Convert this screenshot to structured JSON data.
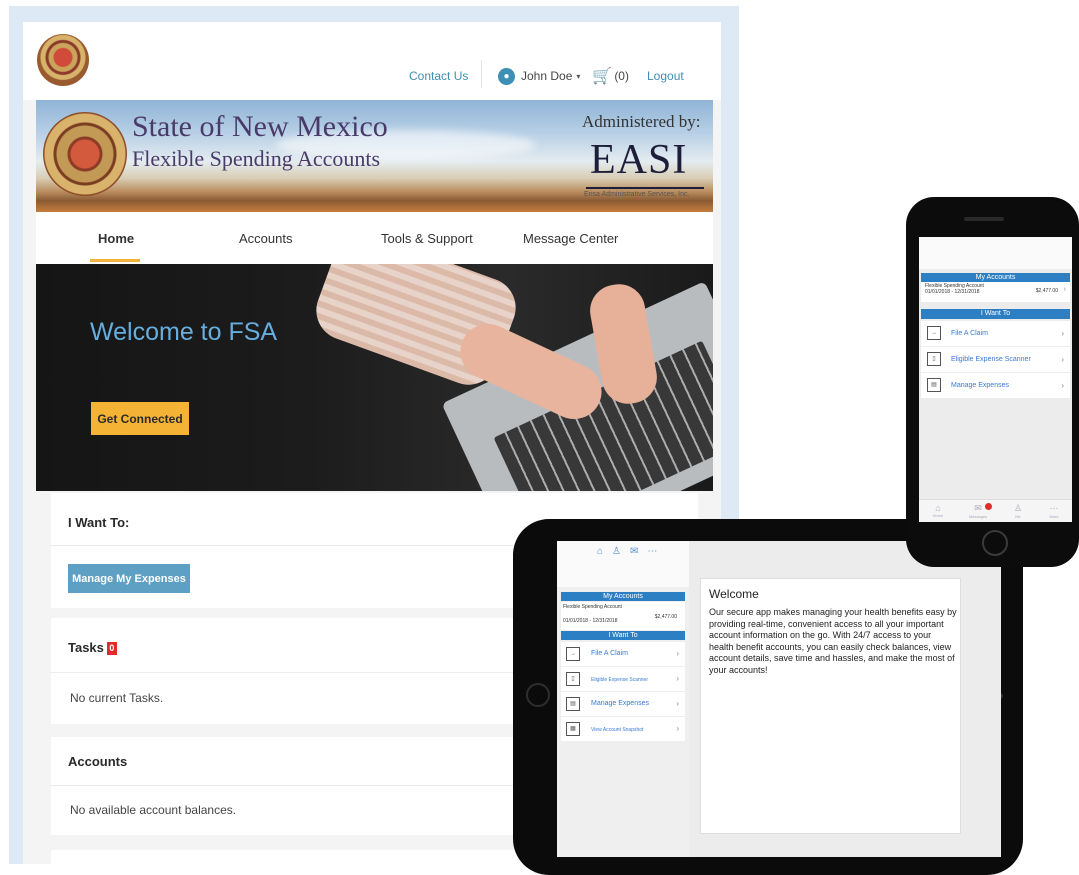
{
  "topbar": {
    "contact_label": "Contact Us",
    "user_name": "John Doe",
    "cart_count": "(0)",
    "logout_label": "Logout"
  },
  "banner": {
    "title": "State of New Mexico",
    "subtitle": "Flexible Spending Accounts",
    "administered_by": "Administered by:",
    "admin_logo": "EASI",
    "admin_fullname": "Erisa Administrative Services, Inc."
  },
  "nav": {
    "items": [
      "Home",
      "Accounts",
      "Tools & Support",
      "Message Center"
    ],
    "active": "Home"
  },
  "hero": {
    "title": "Welcome to FSA",
    "button_label": "Get Connected"
  },
  "i_want_to": {
    "heading": "I Want To:",
    "button_label": "Manage My Expenses"
  },
  "tasks": {
    "heading": "Tasks",
    "badge": "0",
    "empty_text": "No current Tasks."
  },
  "accounts": {
    "heading": "Accounts",
    "empty_text": "No available account balances."
  },
  "tablet": {
    "my_accounts_label": "My Accounts",
    "account_name": "Flexible Spending Account",
    "account_dates": "01/01/2018 - 12/31/2018",
    "account_amount": "$2,477.00",
    "i_want_to_label": "I Want To",
    "items": [
      "File A Claim",
      "Eligible Expense Scanner",
      "Manage Expenses",
      "View Account Snapshot"
    ],
    "welcome_title": "Welcome",
    "welcome_body": "Our secure app makes managing your health benefits easy by providing real-time, convenient access to all your important account information on the go. With 24/7 access to your health benefit accounts, you can easily check balances, view account details, save time and hassles, and make the most of your accounts!"
  },
  "phone": {
    "my_accounts_label": "My Accounts",
    "account_name": "Flexible Spending Account",
    "account_dates": "01/01/2018 - 12/31/2018",
    "account_amount": "$2,477.00",
    "i_want_to_label": "I Want To",
    "items": [
      "File A Claim",
      "Eligible Expense Scanner",
      "Manage Expenses"
    ],
    "tabs": [
      "Home",
      "Messages",
      "Me",
      "More"
    ]
  },
  "colors": {
    "accent_blue": "#3d8fb4",
    "hero_title": "#66aee0",
    "cta_yellow": "#f5b335",
    "button_blue": "#5e9fc4",
    "app_bar_blue": "#2d7fc4",
    "badge_red": "#e12a2a"
  }
}
